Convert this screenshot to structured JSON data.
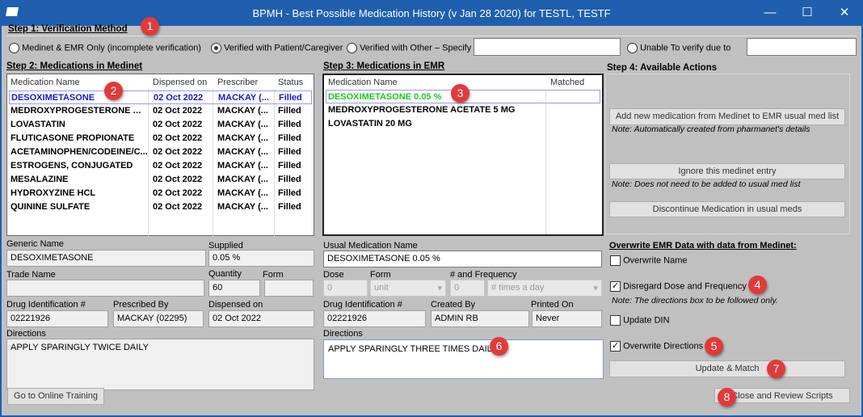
{
  "window": {
    "title": "BPMH - Best Possible Medication History (v Jan 28 2020) for TESTL, TESTF",
    "min": "—",
    "max": "☐",
    "close": "✕"
  },
  "step1": {
    "title": "Step 1: Verification Method",
    "options": [
      "Medinet & EMR Only (incomplete verification)",
      "Verified with Patient/Caregiver",
      "Verified with Other – Specify",
      "Unable To verify due to"
    ],
    "selected": 1,
    "other_value": "",
    "unable_value": ""
  },
  "step2": {
    "title": "Step 2: Medications in Medinet",
    "columns": [
      "Medication Name",
      "Dispensed on",
      "Prescriber",
      "Status"
    ],
    "rows": [
      [
        "DESOXIMETASONE",
        "02 Oct 2022",
        "MACKAY (...",
        "Filled"
      ],
      [
        "MEDROXYPROGESTERONE AC...",
        "02 Oct 2022",
        "MACKAY (...",
        "Filled"
      ],
      [
        "LOVASTATIN",
        "02 Oct 2022",
        "MACKAY (...",
        "Filled"
      ],
      [
        "FLUTICASONE PROPIONATE",
        "02 Oct 2022",
        "MACKAY (...",
        "Filled"
      ],
      [
        "ACETAMINOPHEN/CODEINE/C...",
        "02 Oct 2022",
        "MACKAY (...",
        "Filled"
      ],
      [
        "ESTROGENS, CONJUGATED",
        "02 Oct 2022",
        "MACKAY (...",
        "Filled"
      ],
      [
        "MESALAZINE",
        "02 Oct 2022",
        "MACKAY (...",
        "Filled"
      ],
      [
        "HYDROXYZINE HCL",
        "02 Oct 2022",
        "MACKAY (...",
        "Filled"
      ],
      [
        "QUININE SULFATE",
        "02 Oct 2022",
        "MACKAY (...",
        "Filled"
      ]
    ]
  },
  "step3": {
    "title": "Step 3: Medications in EMR",
    "columns": [
      "Medication Name",
      "Matched"
    ],
    "rows": [
      "DESOXIMETASONE 0.05 %",
      "MEDROXYPROGESTERONE ACETATE 5 MG",
      "LOVASTATIN 20 MG"
    ]
  },
  "step4": {
    "title": "Step 4: Available Actions",
    "add_btn": "Add new medication from Medinet to EMR usual med list",
    "add_note": "Note: Automatically created from pharmanet's details",
    "ignore_btn": "Ignore this medinet entry",
    "ignore_note": "Note: Does not need to be added to usual med list",
    "discontinue_btn": "Discontinue Medication in usual meds",
    "overwrite_title": "Overwrite EMR Data with data from Medinet:",
    "overwrite_name": "Overwrite Name",
    "disregard": "Disregard Dose and Frequency",
    "disregard_note": "Note: The directions box to be followed only.",
    "update_din": "Update DIN",
    "overwrite_directions": "Overwrite Directions",
    "update_match": "Update & Match",
    "close_review": "Close and Review Scripts",
    "check": "✓"
  },
  "medinet_detail": {
    "generic_label": "Generic Name",
    "generic": "DESOXIMETASONE",
    "supplied_label": "Supplied",
    "supplied": "0.05 %",
    "trade_label": "Trade Name",
    "trade": "",
    "quantity_label": "Quantity",
    "quantity": "60",
    "form_label": "Form",
    "form": "",
    "din_label": "Drug Identification #",
    "din": "02221926",
    "prescribed_label": "Prescribed By",
    "prescribed": "MACKAY (02295)",
    "dispensed_label": "Dispensed on",
    "dispensed": "02 Oct 2022",
    "directions_label": "Directions",
    "directions": "APPLY SPARINGLY TWICE DAILY",
    "training_btn": "Go to Online Training"
  },
  "emr_detail": {
    "usual_label": "Usual Medication Name",
    "usual": "DESOXIMETASONE 0.05 %",
    "dose_label": "Dose",
    "dose": "0",
    "form_label": "Form",
    "form": "unit",
    "freq_label": "# and Frequency",
    "freq_num": "0",
    "freq": "# times a day",
    "din_label": "Drug Identification #",
    "din": "02221926",
    "created_label": "Created By",
    "created": "ADMIN RB",
    "printed_label": "Printed On",
    "printed": "Never",
    "directions_label": "Directions",
    "directions": "APPLY SPARINGLY THREE TIMES DAILY"
  },
  "badges": [
    "1",
    "2",
    "3",
    "4",
    "5",
    "6",
    "7",
    "8"
  ]
}
